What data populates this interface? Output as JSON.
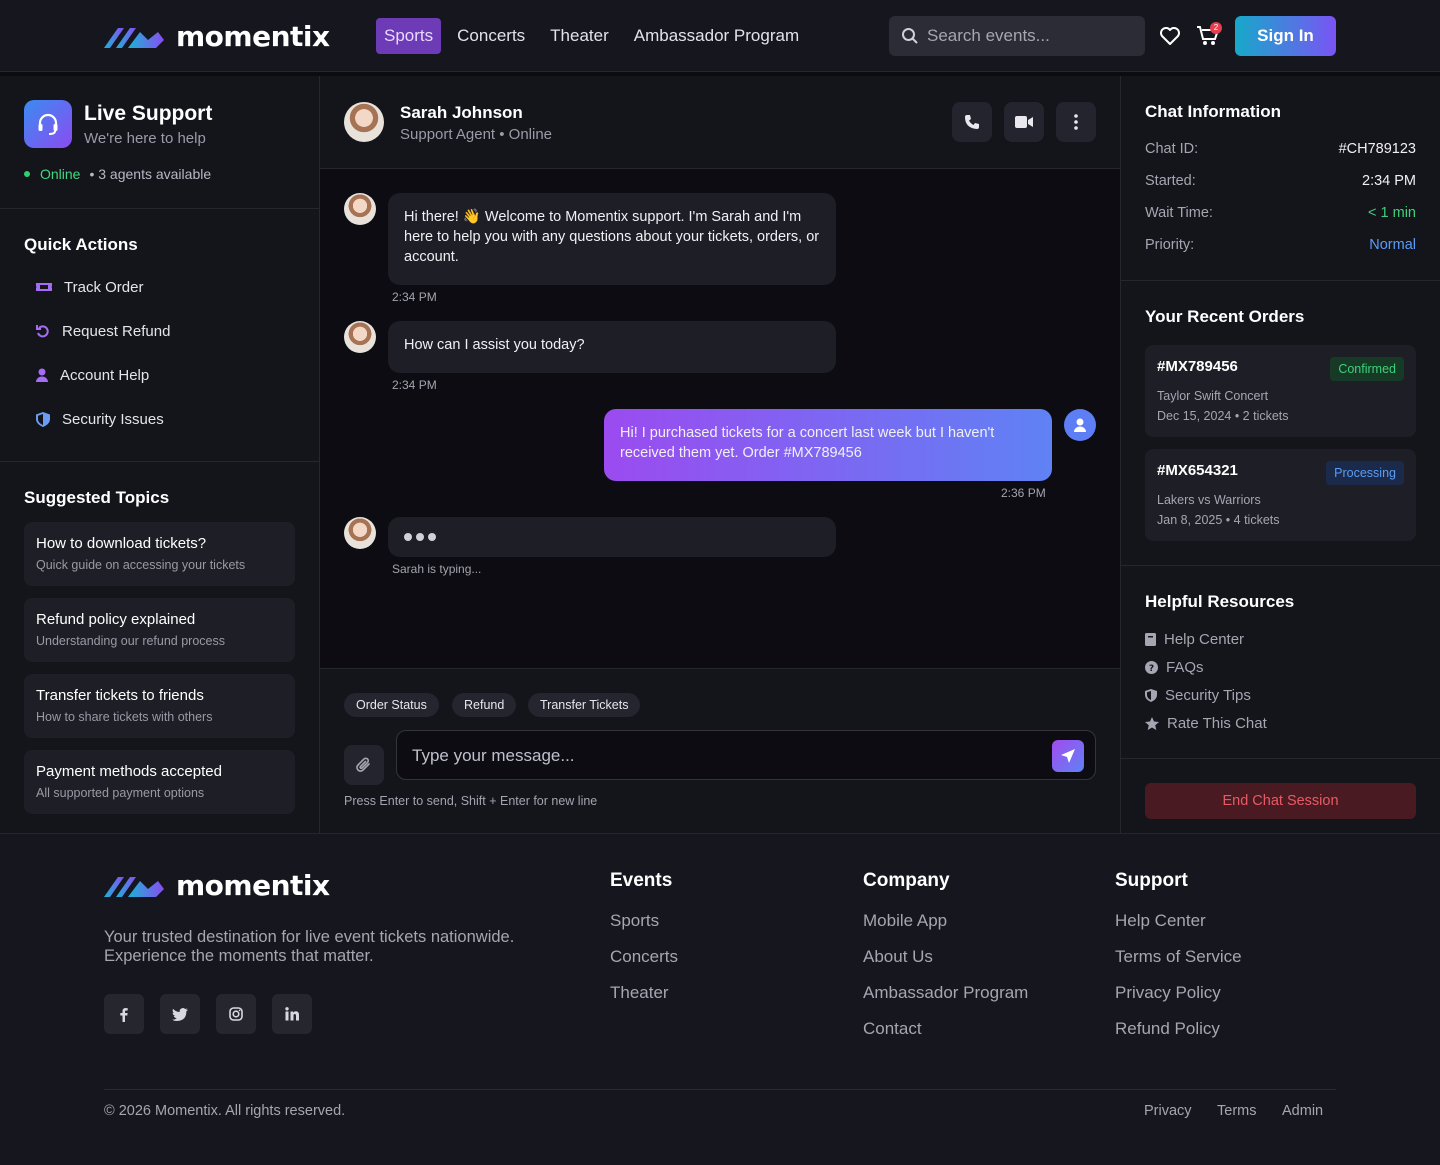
{
  "brand": {
    "name": "momentix"
  },
  "nav": {
    "items": [
      "Sports",
      "Concerts",
      "Theater",
      "Ambassador Program"
    ],
    "active": "Sports"
  },
  "search": {
    "placeholder": "Search events..."
  },
  "cart": {
    "count": "2"
  },
  "header": {
    "signin_label": "Sign In"
  },
  "support": {
    "title": "Live Support",
    "subtitle": "We're here to help",
    "status": "Online",
    "agents": "• 3 agents available"
  },
  "quick_actions": {
    "title": "Quick Actions",
    "items": [
      {
        "label": "Track Order",
        "icon": "ticket-icon"
      },
      {
        "label": "Request Refund",
        "icon": "undo-icon"
      },
      {
        "label": "Account Help",
        "icon": "user-icon"
      },
      {
        "label": "Security Issues",
        "icon": "shield-icon"
      }
    ]
  },
  "topics": {
    "title": "Suggested Topics",
    "items": [
      {
        "title": "How to download tickets?",
        "desc": "Quick guide on accessing your tickets"
      },
      {
        "title": "Refund policy explained",
        "desc": "Understanding our refund process"
      },
      {
        "title": "Transfer tickets to friends",
        "desc": "How to share tickets with others"
      },
      {
        "title": "Payment methods accepted",
        "desc": "All supported payment options"
      }
    ]
  },
  "agent": {
    "name": "Sarah Johnson",
    "role": "Support Agent • Online"
  },
  "messages": [
    {
      "from": "agent",
      "text": "Hi there! 👋 Welcome to Momentix support. I'm Sarah and I'm here to help you with any questions about your tickets, orders, or account.",
      "time": "2:34 PM"
    },
    {
      "from": "agent",
      "text": "How can I assist you today?",
      "time": "2:34 PM"
    },
    {
      "from": "user",
      "text": "Hi! I purchased tickets for a concert last week but I haven't received them yet. Order #MX789456",
      "time": "2:36 PM"
    }
  ],
  "typing": {
    "text": "Sarah is typing..."
  },
  "composer": {
    "chips": [
      "Order Status",
      "Refund",
      "Transfer Tickets"
    ],
    "placeholder": "Type your message...",
    "hint": "Press Enter to send, Shift + Enter for new line"
  },
  "chat_info": {
    "title": "Chat Information",
    "rows": [
      {
        "key": "Chat ID:",
        "value": "#CH789123",
        "color": "#f0f0f4"
      },
      {
        "key": "Started:",
        "value": "2:34 PM",
        "color": "#f0f0f4"
      },
      {
        "key": "Wait Time:",
        "value": "< 1 min",
        "color": "#3fd07a"
      },
      {
        "key": "Priority:",
        "value": "Normal",
        "color": "#5b9cf5"
      }
    ]
  },
  "orders": {
    "title": "Your Recent Orders",
    "items": [
      {
        "id": "#MX789456",
        "status": "Confirmed",
        "status_color": "#3fd07a",
        "status_bg": "#173a26",
        "event": "Taylor Swift Concert",
        "details": "Dec 15, 2024 • 2 tickets"
      },
      {
        "id": "#MX654321",
        "status": "Processing",
        "status_color": "#5b9cf5",
        "status_bg": "#1b2a4a",
        "event": "Lakers vs Warriors",
        "details": "Jan 8, 2025 • 4 tickets"
      }
    ]
  },
  "resources": {
    "title": "Helpful Resources",
    "items": [
      {
        "label": "Help Center",
        "icon": "book-icon"
      },
      {
        "label": "FAQs",
        "icon": "question-icon"
      },
      {
        "label": "Security Tips",
        "icon": "shield-icon"
      },
      {
        "label": "Rate This Chat",
        "icon": "star-icon"
      }
    ]
  },
  "end_chat": {
    "label": "End Chat Session"
  },
  "footer": {
    "description": "Your trusted destination for live event tickets nationwide.\nExperience the moments that matter.",
    "social": [
      "f",
      "t",
      "ig",
      "in"
    ],
    "columns": [
      {
        "title": "Events",
        "links": [
          "Sports",
          "Concerts",
          "Theater"
        ]
      },
      {
        "title": "Company",
        "links": [
          "Mobile App",
          "About Us",
          "Ambassador Program",
          "Contact"
        ]
      },
      {
        "title": "Support",
        "links": [
          "Help Center",
          "Terms of Service",
          "Privacy Policy",
          "Refund Policy"
        ]
      }
    ],
    "copyright": "© 2026 Momentix. All rights reserved.",
    "bottom_links": [
      "Privacy",
      "Terms",
      "Admin"
    ]
  },
  "colors": {
    "accent": "#7a54f4",
    "brand_gradient_start": "#16a9c9",
    "online": "#2fd16f"
  }
}
